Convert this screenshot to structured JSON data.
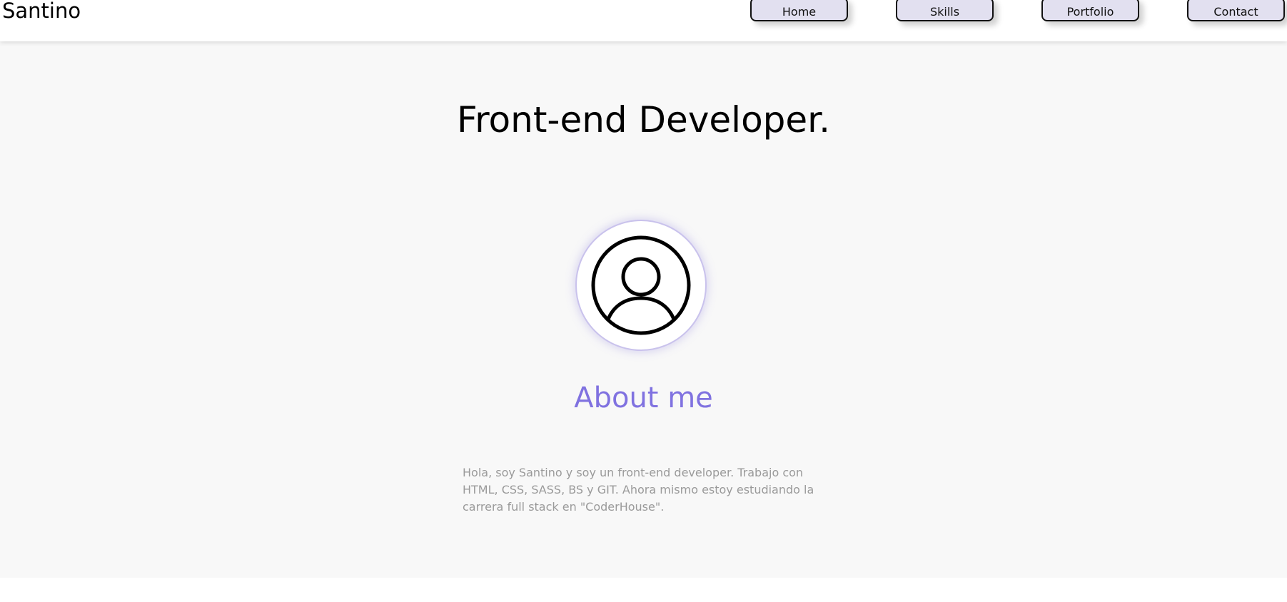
{
  "header": {
    "brand": "Santino",
    "nav": [
      {
        "label": "Home"
      },
      {
        "label": "Skills"
      },
      {
        "label": "Portfolio"
      },
      {
        "label": "Contact"
      }
    ]
  },
  "hero": {
    "title": "Front-end Developer."
  },
  "about": {
    "avatar_icon": "user-circle-icon",
    "title": "About me",
    "text": "Hola, soy Santino y soy un front-end developer. Trabajo con HTML, CSS, SASS, BS y GIT. Ahora mismo estoy estudiando la carrera full stack en \"CoderHouse\"."
  },
  "colors": {
    "accent": "#8072e0",
    "nav_button_bg": "#e2e0f0",
    "page_bg": "#f8f8f8",
    "body_text": "#9a9a9a"
  }
}
